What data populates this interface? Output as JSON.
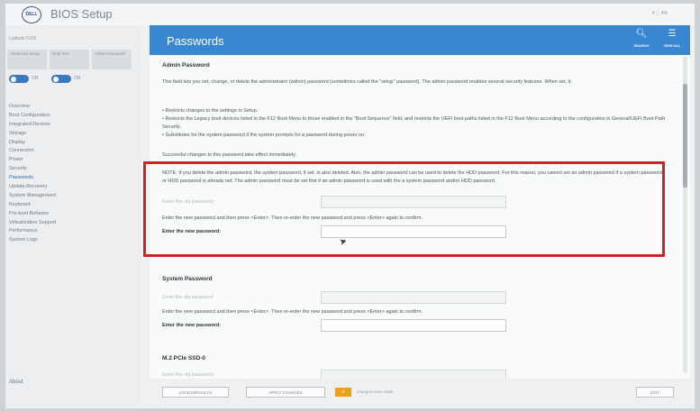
{
  "app": {
    "logo_text": "DELL",
    "title": "BIOS Setup",
    "top_right": "4 ⬚ 4%"
  },
  "sidebar": {
    "model": "Latitude 5320",
    "cards": [
      "Advanced Setup",
      "Help Text",
      "Admin Password"
    ],
    "toggles": [
      "ON",
      "ON"
    ],
    "nav": [
      "Overview",
      "Boot Configuration",
      "Integrated Devices",
      "Storage",
      "Display",
      "Connection",
      "Power",
      "Security",
      "Passwords",
      "Update,Recovery",
      "System Management",
      "Keyboard",
      "Pre-boot Behavior",
      "Virtualization Support",
      "Performance",
      "System Logs"
    ],
    "active": "Passwords",
    "about": "About"
  },
  "header": {
    "title": "Passwords",
    "search_label": "SEARCH",
    "view_all_label": "VIEW ALL"
  },
  "admin": {
    "title": "Admin Password",
    "description": "This field lets you set, change, or delete the administrator (admin) password (sometimes called the \"setup\" password). The admin password enables several security features. When set, it:",
    "bullets": [
      "Restricts changes to the settings in Setup.",
      "Restricts the Legacy boot devices listed in the F12 Boot Menu to those enabled in the \"Boot Sequence\" field, and restricts the UEFI boot paths listed in the F12 Boot Menu according to the configuration in General/UEFI Boot Path Security.",
      "Substitutes for the system password if the system prompts for a password during power on."
    ],
    "success_note": "Successful changes to this password take effect immediately.",
    "note": "NOTE: If you delete the admin password, the system password, if set, is also deleted. Also, the admin password can be used to delete the HDD password. For this reason, you cannot set an admin password if a system password or HDD password is already set. The admin password must be set first if an admin password is used with the a system password and/or HDD password.",
    "old_label": "Enter the old password:",
    "instructions": "Enter the new password and then press <Enter>. Then re-enter the new password and press <Enter> again to confirm.",
    "new_label": "Enter the new password:"
  },
  "system": {
    "title": "System Password",
    "old_label": "Enter the old password:",
    "instructions": "Enter the new password and then press <Enter>. Then re-enter the new password and press <Enter> again to confirm.",
    "new_label": "Enter the new password:"
  },
  "ssd": {
    "title": "M.2 PCIe SSD-0",
    "old_label": "Enter the old password:"
  },
  "footer": {
    "load_defaults": "LOAD DEFAULTS",
    "apply_changes": "APPLY CHANGES",
    "changes_count": "0",
    "status": "changes were made",
    "exit": "EXIT"
  },
  "colors": {
    "accent": "#3a87d1",
    "highlight": "#d0242b",
    "status": "#e8a21c"
  }
}
